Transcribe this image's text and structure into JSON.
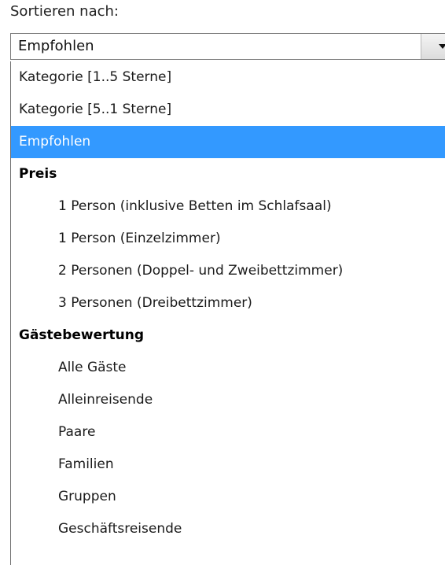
{
  "sort": {
    "label": "Sortieren nach:",
    "selected_value": "Empfohlen",
    "arrow_icon": "chevron-down-icon"
  },
  "options": [
    {
      "label": "Kategorie [1..5 Sterne]",
      "kind": "option",
      "selected": false
    },
    {
      "label": "Kategorie [5..1 Sterne]",
      "kind": "option",
      "selected": false
    },
    {
      "label": "Empfohlen",
      "kind": "option",
      "selected": true
    },
    {
      "label": "Preis",
      "kind": "group"
    },
    {
      "label": "1 Person (inklusive Betten im Schlafsaal)",
      "kind": "sub-option",
      "selected": false
    },
    {
      "label": "1 Person (Einzelzimmer)",
      "kind": "sub-option",
      "selected": false
    },
    {
      "label": "2 Personen (Doppel- und Zweibettzimmer)",
      "kind": "sub-option",
      "selected": false
    },
    {
      "label": "3 Personen (Dreibettzimmer)",
      "kind": "sub-option",
      "selected": false
    },
    {
      "label": "Gästebewertung",
      "kind": "group"
    },
    {
      "label": "Alle Gäste",
      "kind": "sub-option",
      "selected": false
    },
    {
      "label": "Alleinreisende",
      "kind": "sub-option",
      "selected": false
    },
    {
      "label": "Paare",
      "kind": "sub-option",
      "selected": false
    },
    {
      "label": "Familien",
      "kind": "sub-option",
      "selected": false
    },
    {
      "label": "Gruppen",
      "kind": "sub-option",
      "selected": false
    },
    {
      "label": "Geschäftsreisende",
      "kind": "sub-option",
      "selected": false
    }
  ],
  "colors": {
    "selection_bg": "#3399ff",
    "selection_text": "#ffffff"
  }
}
